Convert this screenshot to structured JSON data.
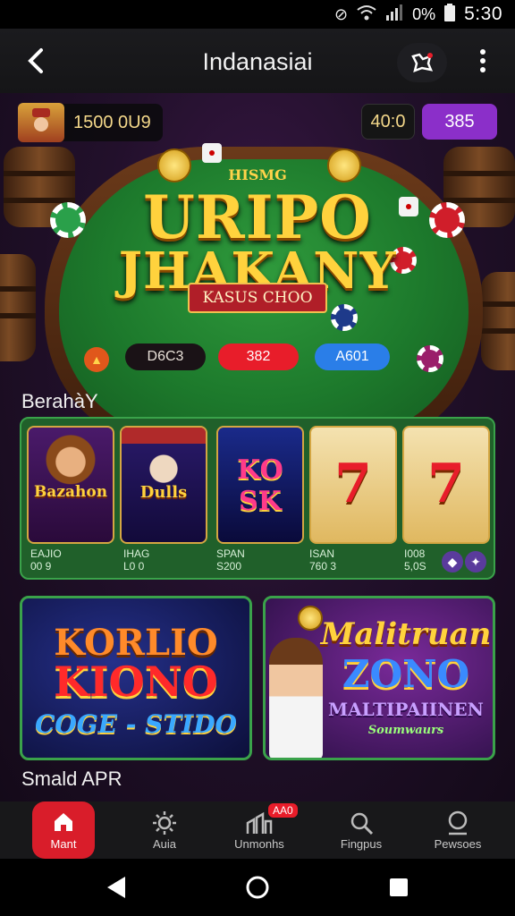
{
  "status_bar": {
    "time": "5:30",
    "battery": "0%"
  },
  "app_bar": {
    "title": "Indanasiai"
  },
  "hud": {
    "coins": "1500 0U9",
    "gold_value": "40:0",
    "purple_value": "385"
  },
  "table": {
    "logo_small": "HISMG",
    "logo_line1": "URIPO",
    "logo_line2": "JHAKANY",
    "logo_ribbon": "KASUS CHOO",
    "btn_dark": "D6C3",
    "btn_red": "382",
    "btn_blue": "A601"
  },
  "section1_title": "BerahàY",
  "slots": [
    {
      "title": "Bazahon",
      "caption1": "EAJIO",
      "caption2": "00 9"
    },
    {
      "title": "Dulls",
      "caption1": "IHAG",
      "caption2": "L0 0"
    },
    {
      "title": "KO SK",
      "caption1": "SPAN",
      "caption2": "S200"
    },
    {
      "title": "7",
      "caption1": "ISAN",
      "caption2": "760 3"
    },
    {
      "title": "7",
      "caption1": "I008",
      "caption2": "5,0S"
    }
  ],
  "promos": [
    {
      "line1": "KORLIO",
      "line2": "KIONO",
      "line3": "COGE - STIDO"
    },
    {
      "line1": "Malitruan",
      "line2": "ZONO",
      "line3": "MALTIPAIINEN",
      "line4": "Soumwaurs"
    }
  ],
  "section2_title": "Smald APR",
  "bottom_nav": [
    {
      "label": "Mant",
      "icon": "home-icon"
    },
    {
      "label": "Auia",
      "icon": "sun-icon"
    },
    {
      "label": "Unmonhs",
      "icon": "chart-icon",
      "badge": "AA0"
    },
    {
      "label": "Fingpus",
      "icon": "search-icon"
    },
    {
      "label": "Pewsoes",
      "icon": "profile-icon"
    }
  ],
  "colors": {
    "accent_red": "#d91d2a",
    "felt_green": "#1d7a2c",
    "gold": "#ffd23d",
    "purple": "#8b2fc9"
  }
}
